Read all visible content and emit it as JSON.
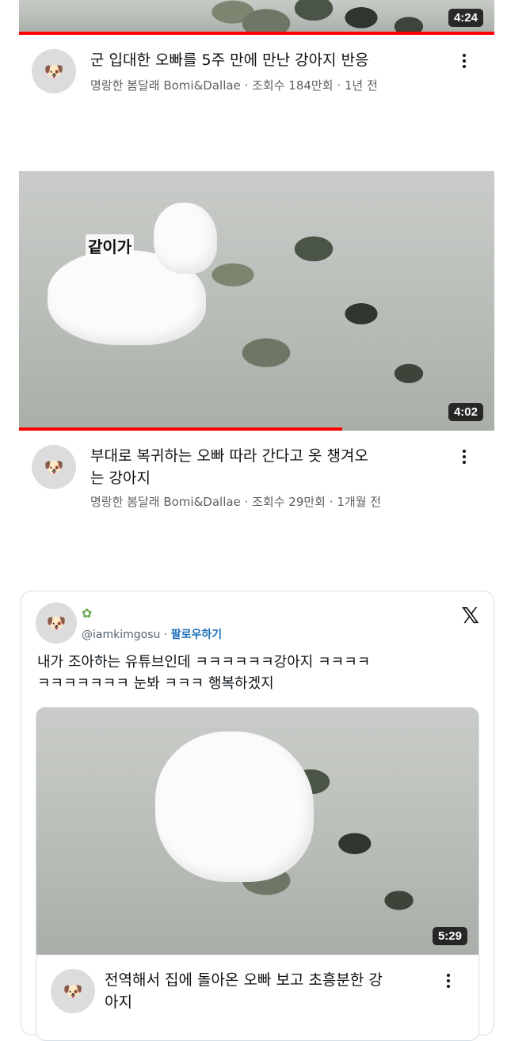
{
  "videos": [
    {
      "title": "군 입대한  오빠를 5주 만에 만난 강아지 반응",
      "channel": "명랑한 봄달래 Bomi&Dallae",
      "views": "조회수 184만회",
      "age": "1년 전",
      "duration": "4:24",
      "progress": 1.0
    },
    {
      "title_line1": "부대로 복귀하는 오빠 따라 간다고 옷 챙겨오",
      "title_line2": "는 강아지",
      "channel": "명랑한 봄달래 Bomi&Dallae",
      "views": "조회수 29만회",
      "age": "1개월 전",
      "duration": "4:02",
      "caption": "같이가",
      "progress": 0.68
    }
  ],
  "meta_separator": "·",
  "tweet": {
    "handle": "@iamkimgosu",
    "separator": "·",
    "follow_label": "팔로우하기",
    "text_line1": "내가 조아하는 유튜브인데 ㅋㅋㅋㅋㅋㅋ강아지 ㅋㅋㅋㅋ",
    "text_line2": "ㅋㅋㅋㅋㅋㅋㅋ 눈봐 ㅋㅋㅋ 행복하겠지",
    "x_logo": "𝕏",
    "embedded_video": {
      "duration": "5:29",
      "title_line1": "전역해서 집에 돌아온 오빠 보고 초흥분한 강",
      "title_line2": "아지"
    }
  },
  "icons": {
    "avatar": "dog-avatar-icon",
    "more": "kebab-icon",
    "x": "x-logo-icon",
    "sprout": "sprout-icon"
  },
  "colors": {
    "progress": "#ff0000",
    "follow": "#1d6fb8"
  }
}
